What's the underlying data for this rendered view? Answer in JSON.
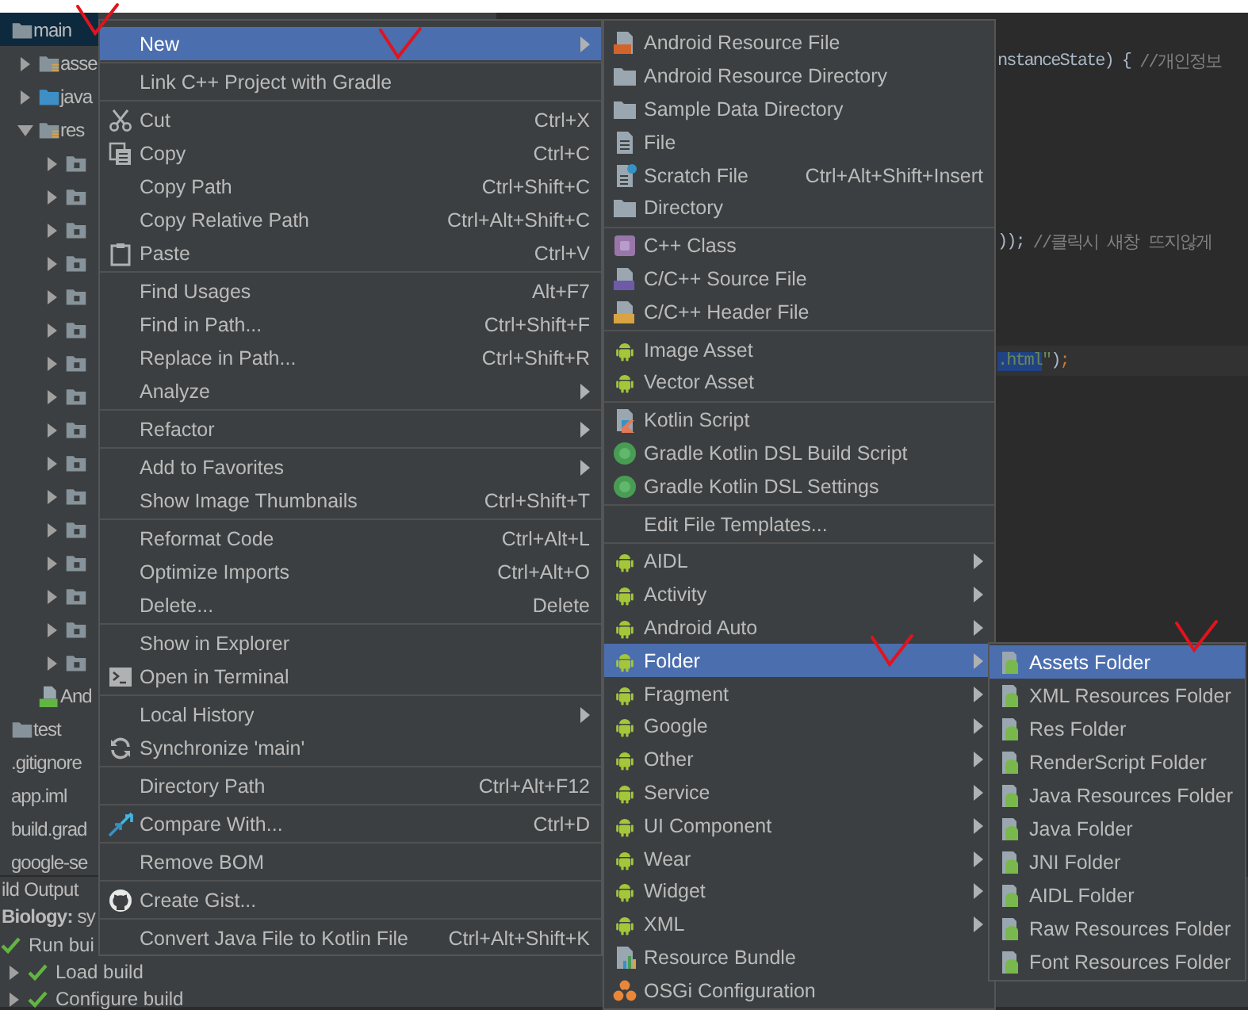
{
  "project_tree": {
    "items": [
      {
        "label": "main",
        "kind": "folder",
        "selected": true,
        "children": [
          {
            "label": "asse",
            "kind": "resource-folder",
            "expanded": false,
            "selected": false
          },
          {
            "label": "java",
            "kind": "source-folder",
            "expanded": false,
            "selected": false
          },
          {
            "label": "res",
            "kind": "resource-folder",
            "expanded": true,
            "selected": false,
            "children": [
              {
                "kind": "package-folder",
                "expanded": false,
                "selected": false
              },
              {
                "kind": "package-folder",
                "expanded": false,
                "selected": false
              },
              {
                "kind": "package-folder",
                "expanded": false,
                "selected": false
              },
              {
                "kind": "package-folder",
                "expanded": false,
                "selected": false
              },
              {
                "kind": "package-folder",
                "expanded": false,
                "selected": false
              },
              {
                "kind": "package-folder",
                "expanded": false,
                "selected": false
              },
              {
                "kind": "package-folder",
                "expanded": false,
                "selected": false
              },
              {
                "kind": "package-folder",
                "expanded": false,
                "selected": false
              },
              {
                "kind": "package-folder",
                "expanded": false,
                "selected": false
              },
              {
                "kind": "package-folder",
                "expanded": false,
                "selected": false
              },
              {
                "kind": "package-folder",
                "expanded": false,
                "selected": false
              },
              {
                "kind": "package-folder",
                "expanded": false,
                "selected": false
              },
              {
                "kind": "package-folder",
                "expanded": false,
                "selected": false
              },
              {
                "kind": "package-folder",
                "expanded": false,
                "selected": false
              },
              {
                "kind": "package-folder",
                "expanded": false,
                "selected": false
              },
              {
                "kind": "package-folder",
                "expanded": false,
                "selected": false
              }
            ]
          },
          {
            "label": "And",
            "kind": "manifest",
            "selected": false
          }
        ]
      },
      {
        "label": "test",
        "kind": "folder",
        "selected": false
      },
      {
        "label": ".gitignore",
        "kind": "file",
        "selected": false
      },
      {
        "label": "app.iml",
        "kind": "file",
        "selected": false
      },
      {
        "label": "build.grad",
        "kind": "file",
        "selected": false
      },
      {
        "label": "google-se",
        "kind": "file",
        "selected": false
      }
    ]
  },
  "editor": {
    "lines": [
      {
        "current": false,
        "segments": [
          {
            "text": "nstanceState) { ",
            "kind": "code",
            "selected": false
          },
          {
            "text": "//개인정보",
            "kind": "comment",
            "selected": false
          }
        ]
      },
      {
        "current": false,
        "segments": [
          {
            "text": ")); ",
            "kind": "code",
            "selected": false
          },
          {
            "text": "//클릭시 새창 뜨지않게",
            "kind": "comment",
            "selected": false
          }
        ]
      },
      {
        "current": true,
        "segments": [
          {
            "text": ".html",
            "kind": "string",
            "selected": true
          },
          {
            "text": "\"",
            "kind": "string",
            "selected": false
          },
          {
            "text": ")",
            "kind": "code",
            "selected": false
          },
          {
            "text": ";",
            "kind": "keyword",
            "selected": false
          }
        ]
      }
    ]
  },
  "build_output": {
    "title": "ild Output",
    "rows": [
      {
        "kind": "summary",
        "text": "**Biology:** sy"
      },
      {
        "kind": "task",
        "label": "Run bui",
        "succeeded": true,
        "children": [
          {
            "kind": "task",
            "label": "Load build",
            "expanded": false,
            "succeeded": true
          },
          {
            "kind": "task",
            "label": "Configure build",
            "expanded": false,
            "succeeded": true
          }
        ]
      }
    ]
  },
  "context_menu": {
    "items": [
      {
        "kind": "plain",
        "label": "New",
        "selected": true,
        "submenu": true
      },
      {
        "kind": "separator"
      },
      {
        "kind": "plain",
        "label": "Link C++ Project with Gradle",
        "selected": false,
        "submenu": false
      },
      {
        "kind": "separator"
      },
      {
        "kind": "cut",
        "label": "Cut",
        "shortcut": "Ctrl+X",
        "selected": false,
        "submenu": false
      },
      {
        "kind": "copy",
        "label": "Copy",
        "shortcut": "Ctrl+C",
        "selected": false,
        "submenu": false
      },
      {
        "kind": "plain",
        "label": "Copy Path",
        "shortcut": "Ctrl+Shift+C",
        "selected": false,
        "submenu": false
      },
      {
        "kind": "plain",
        "label": "Copy Relative Path",
        "shortcut": "Ctrl+Alt+Shift+C",
        "selected": false,
        "submenu": false
      },
      {
        "kind": "paste",
        "label": "Paste",
        "shortcut": "Ctrl+V",
        "selected": false,
        "submenu": false
      },
      {
        "kind": "separator"
      },
      {
        "kind": "plain",
        "label": "Find Usages",
        "shortcut": "Alt+F7",
        "selected": false,
        "submenu": false
      },
      {
        "kind": "plain",
        "label": "Find in Path...",
        "shortcut": "Ctrl+Shift+F",
        "selected": false,
        "submenu": false
      },
      {
        "kind": "plain",
        "label": "Replace in Path...",
        "shortcut": "Ctrl+Shift+R",
        "selected": false,
        "submenu": false
      },
      {
        "kind": "plain",
        "label": "Analyze",
        "selected": false,
        "submenu": true
      },
      {
        "kind": "separator"
      },
      {
        "kind": "plain",
        "label": "Refactor",
        "selected": false,
        "submenu": true
      },
      {
        "kind": "separator"
      },
      {
        "kind": "plain",
        "label": "Add to Favorites",
        "selected": false,
        "submenu": true
      },
      {
        "kind": "plain",
        "label": "Show Image Thumbnails",
        "shortcut": "Ctrl+Shift+T",
        "selected": false,
        "submenu": false
      },
      {
        "kind": "separator"
      },
      {
        "kind": "plain",
        "label": "Reformat Code",
        "shortcut": "Ctrl+Alt+L",
        "selected": false,
        "submenu": false
      },
      {
        "kind": "plain",
        "label": "Optimize Imports",
        "shortcut": "Ctrl+Alt+O",
        "selected": false,
        "submenu": false
      },
      {
        "kind": "plain",
        "label": "Delete...",
        "shortcut": "Delete",
        "selected": false,
        "submenu": false
      },
      {
        "kind": "separator"
      },
      {
        "kind": "plain",
        "label": "Show in Explorer",
        "selected": false,
        "submenu": false
      },
      {
        "kind": "terminal",
        "label": "Open in Terminal",
        "selected": false,
        "submenu": false
      },
      {
        "kind": "separator"
      },
      {
        "kind": "plain",
        "label": "Local History",
        "selected": false,
        "submenu": true
      },
      {
        "kind": "sync",
        "label": "Synchronize 'main'",
        "selected": false,
        "submenu": false
      },
      {
        "kind": "separator"
      },
      {
        "kind": "plain",
        "label": "Directory Path",
        "shortcut": "Ctrl+Alt+F12",
        "selected": false,
        "submenu": false
      },
      {
        "kind": "separator"
      },
      {
        "kind": "compare",
        "label": "Compare With...",
        "shortcut": "Ctrl+D",
        "selected": false,
        "submenu": false
      },
      {
        "kind": "separator"
      },
      {
        "kind": "plain",
        "label": "Remove BOM",
        "selected": false,
        "submenu": false
      },
      {
        "kind": "separator"
      },
      {
        "kind": "gist",
        "label": "Create Gist...",
        "selected": false,
        "submenu": false
      },
      {
        "kind": "separator"
      },
      {
        "kind": "plain",
        "label": "Convert Java File to Kotlin File",
        "shortcut": "Ctrl+Alt+Shift+K",
        "selected": false,
        "submenu": false
      }
    ]
  },
  "new_submenu": {
    "items": [
      {
        "kind": "resource-file",
        "label": "Android Resource File",
        "selected": false,
        "submenu": false
      },
      {
        "kind": "directory",
        "label": "Android Resource Directory",
        "selected": false,
        "submenu": false
      },
      {
        "kind": "directory",
        "label": "Sample Data Directory",
        "selected": false,
        "submenu": false
      },
      {
        "kind": "file",
        "label": "File",
        "selected": false,
        "submenu": false
      },
      {
        "kind": "scratch-file",
        "label": "Scratch File",
        "shortcut": "Ctrl+Alt+Shift+Insert",
        "selected": false,
        "submenu": false
      },
      {
        "kind": "directory",
        "label": "Directory",
        "selected": false,
        "submenu": false
      },
      {
        "kind": "separator"
      },
      {
        "kind": "cpp-class",
        "label": "C++ Class",
        "selected": false,
        "submenu": false
      },
      {
        "kind": "cpp-source",
        "label": "C/C++ Source File",
        "selected": false,
        "submenu": false
      },
      {
        "kind": "cpp-header",
        "label": "C/C++ Header File",
        "selected": false,
        "submenu": false
      },
      {
        "kind": "separator"
      },
      {
        "kind": "android",
        "label": "Image Asset",
        "selected": false,
        "submenu": false
      },
      {
        "kind": "android",
        "label": "Vector Asset",
        "selected": false,
        "submenu": false
      },
      {
        "kind": "separator"
      },
      {
        "kind": "kotlin-script",
        "label": "Kotlin Script",
        "selected": false,
        "submenu": false
      },
      {
        "kind": "gradle",
        "label": "Gradle Kotlin DSL Build Script",
        "selected": false,
        "submenu": false
      },
      {
        "kind": "gradle",
        "label": "Gradle Kotlin DSL Settings",
        "selected": false,
        "submenu": false
      },
      {
        "kind": "separator"
      },
      {
        "kind": "plain",
        "label": "Edit File Templates...",
        "selected": false,
        "submenu": false
      },
      {
        "kind": "separator"
      },
      {
        "kind": "android",
        "label": "AIDL",
        "selected": false,
        "submenu": true
      },
      {
        "kind": "android",
        "label": "Activity",
        "selected": false,
        "submenu": true
      },
      {
        "kind": "android",
        "label": "Android Auto",
        "selected": false,
        "submenu": true
      },
      {
        "kind": "android",
        "label": "Folder",
        "selected": true,
        "submenu": true
      },
      {
        "kind": "android",
        "label": "Fragment",
        "selected": false,
        "submenu": true
      },
      {
        "kind": "android",
        "label": "Google",
        "selected": false,
        "submenu": true
      },
      {
        "kind": "android",
        "label": "Other",
        "selected": false,
        "submenu": true
      },
      {
        "kind": "android",
        "label": "Service",
        "selected": false,
        "submenu": true
      },
      {
        "kind": "android",
        "label": "UI Component",
        "selected": false,
        "submenu": true
      },
      {
        "kind": "android",
        "label": "Wear",
        "selected": false,
        "submenu": true
      },
      {
        "kind": "android",
        "label": "Widget",
        "selected": false,
        "submenu": true
      },
      {
        "kind": "android",
        "label": "XML",
        "selected": false,
        "submenu": true
      },
      {
        "kind": "resource-bundle",
        "label": "Resource Bundle",
        "selected": false,
        "submenu": false
      },
      {
        "kind": "osgi",
        "label": "OSGi Configuration",
        "selected": false,
        "submenu": false
      }
    ]
  },
  "folder_submenu": {
    "items": [
      {
        "kind": "android-folder",
        "label": "Assets Folder",
        "selected": true,
        "submenu": false
      },
      {
        "kind": "android-folder",
        "label": "XML Resources Folder",
        "selected": false,
        "submenu": false
      },
      {
        "kind": "android-folder",
        "label": "Res Folder",
        "selected": false,
        "submenu": false
      },
      {
        "kind": "android-folder",
        "label": "RenderScript Folder",
        "selected": false,
        "submenu": false
      },
      {
        "kind": "android-folder",
        "label": "Java Resources Folder",
        "selected": false,
        "submenu": false
      },
      {
        "kind": "android-folder",
        "label": "Java Folder",
        "selected": false,
        "submenu": false
      },
      {
        "kind": "android-folder",
        "label": "JNI Folder",
        "selected": false,
        "submenu": false
      },
      {
        "kind": "android-folder",
        "label": "AIDL Folder",
        "selected": false,
        "submenu": false
      },
      {
        "kind": "android-folder",
        "label": "Raw Resources Folder",
        "selected": false,
        "submenu": false
      },
      {
        "kind": "android-folder",
        "label": "Font Resources Folder",
        "selected": false,
        "submenu": false
      }
    ]
  },
  "annotations": [
    {
      "kind": "check"
    },
    {
      "kind": "check"
    },
    {
      "kind": "check"
    },
    {
      "kind": "check"
    }
  ]
}
